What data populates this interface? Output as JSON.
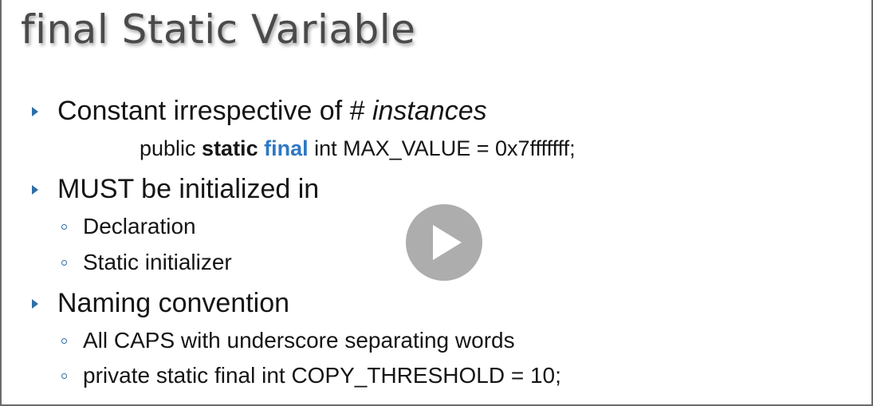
{
  "slide": {
    "title": "final Static Variable",
    "bullets": [
      {
        "text_before": "Constant irrespective of # ",
        "text_italic": "instances",
        "code": {
          "prefix": "public ",
          "static_kw": "static",
          "final_kw": "final",
          "suffix": " int MAX_VALUE = 0x7fffffff;"
        }
      },
      {
        "text": "MUST be initialized in",
        "sub_items": [
          "Declaration",
          "Static initializer"
        ]
      },
      {
        "text": "Naming convention",
        "sub_items": [
          "All CAPS with underscore separating words",
          "private static final int COPY_THRESHOLD = 10;"
        ]
      }
    ]
  },
  "video": {
    "play_icon": "play-icon"
  },
  "colors": {
    "bullet_accent": "#2e6fa7",
    "final_keyword": "#2e78c4",
    "title_text": "#4a4a4a"
  }
}
